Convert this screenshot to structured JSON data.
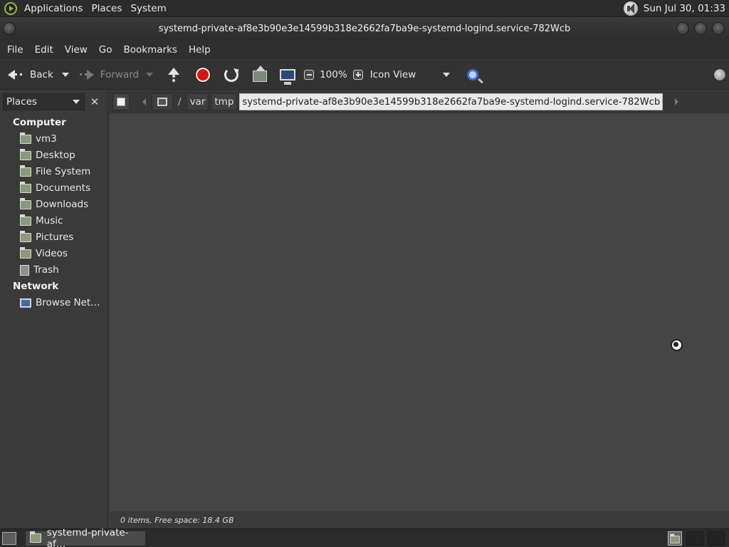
{
  "top_panel": {
    "menus": [
      "Applications",
      "Places",
      "System"
    ],
    "clock": "Sun Jul 30, 01:33"
  },
  "window": {
    "title": "systemd-private-af8e3b90e3e14599b318e2662fa7ba9e-systemd-logind.service-782Wcb"
  },
  "menubar": {
    "items": [
      "File",
      "Edit",
      "View",
      "Go",
      "Bookmarks",
      "Help"
    ]
  },
  "toolbar": {
    "back_label": "Back",
    "forward_label": "Forward",
    "zoom_level": "100%",
    "view_mode": "Icon View"
  },
  "sidebar": {
    "selector": "Places",
    "close_glyph": "✕",
    "sections": [
      {
        "title": "Computer",
        "items": [
          {
            "label": "vm3",
            "icon": "home-folder-icon"
          },
          {
            "label": "Desktop",
            "icon": "folder-icon"
          },
          {
            "label": "File System",
            "icon": "folder-icon"
          },
          {
            "label": "Documents",
            "icon": "folder-icon"
          },
          {
            "label": "Downloads",
            "icon": "folder-icon"
          },
          {
            "label": "Music",
            "icon": "folder-icon"
          },
          {
            "label": "Pictures",
            "icon": "folder-icon"
          },
          {
            "label": "Videos",
            "icon": "folder-icon"
          },
          {
            "label": "Trash",
            "icon": "trash-icon"
          }
        ]
      },
      {
        "title": "Network",
        "items": [
          {
            "label": "Browse Net…",
            "icon": "network-icon"
          }
        ]
      }
    ]
  },
  "pathbar": {
    "separator": "/",
    "crumbs": [
      "var",
      "tmp"
    ],
    "current": "systemd-private-af8e3b90e3e14599b318e2662fa7ba9e-systemd-logind.service-782Wcb"
  },
  "statusbar": {
    "text": "0 items, Free space: 18.4 GB"
  },
  "taskbar": {
    "task_label": "systemd-private-af…"
  }
}
